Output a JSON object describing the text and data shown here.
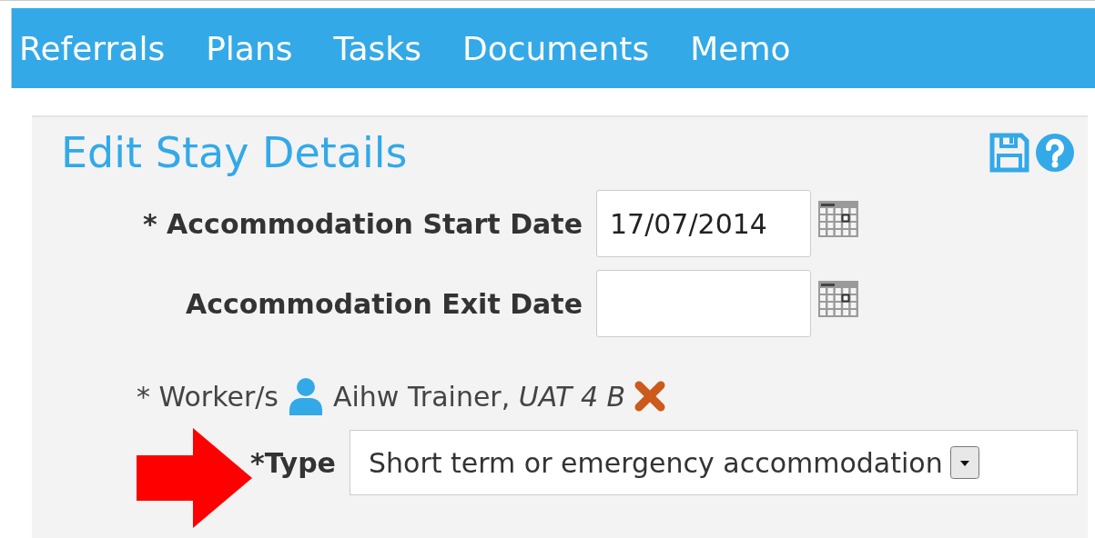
{
  "nav": [
    "Referrals",
    "Plans",
    "Tasks",
    "Documents",
    "Memo"
  ],
  "panel": {
    "title": "Edit Stay Details",
    "date_fields": [
      {
        "label": "* Accommodation Start Date",
        "value": "17/07/2014"
      },
      {
        "label": "Accommodation Exit Date"
      }
    ],
    "worker": {
      "label": "* Worker/s",
      "value": "Aihw Trainer, *UAT 4 B*"
    },
    "type": {
      "label": "*Type",
      "value": "Short term or emergency accommodation"
    }
  }
}
